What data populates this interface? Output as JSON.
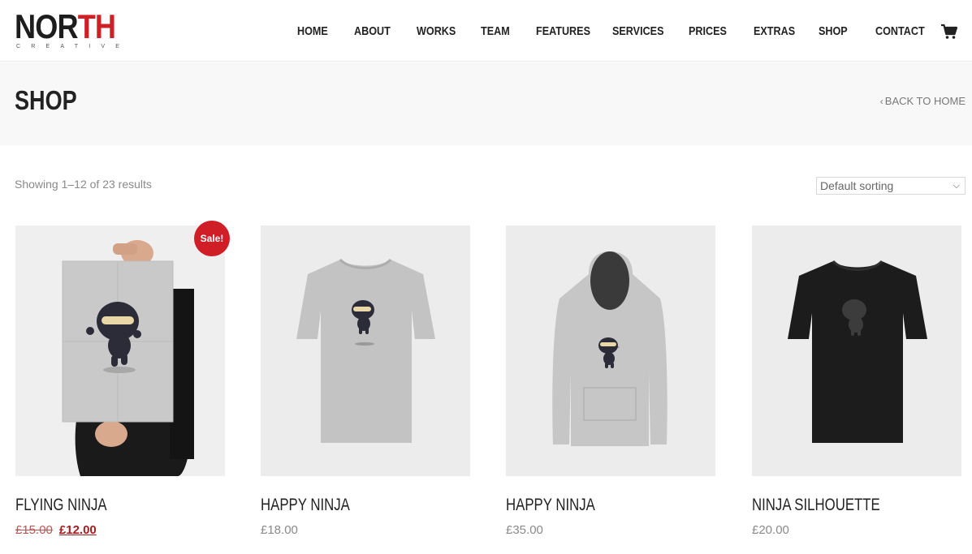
{
  "brand": {
    "name_part1": "NOR",
    "name_part2": "TH",
    "subtitle": "CREATIVE"
  },
  "nav": {
    "items": [
      "HOME",
      "ABOUT",
      "WORKS",
      "TEAM",
      "FEATURES",
      "SERVICES",
      "PRICES",
      "EXTRAS",
      "SHOP",
      "CONTACT"
    ],
    "cart_icon": "shopping-cart-icon"
  },
  "page": {
    "title": "SHOP",
    "back_link": "BACK TO HOME"
  },
  "results": {
    "count_text": "Showing 1–12 of 23 results",
    "sorting_value": "Default sorting"
  },
  "products": [
    {
      "name": "FLYING NINJA",
      "old_price": "£15.00",
      "price": "£12.00",
      "badge": "Sale!"
    },
    {
      "name": "HAPPY NINJA",
      "price": "£18.00"
    },
    {
      "name": "HAPPY NINJA",
      "price": "£35.00"
    },
    {
      "name": "NINJA SILHOUETTE",
      "price": "£20.00"
    }
  ],
  "colors": {
    "accent": "#cf2027",
    "text": "#222222",
    "muted": "#8a8a8a"
  }
}
